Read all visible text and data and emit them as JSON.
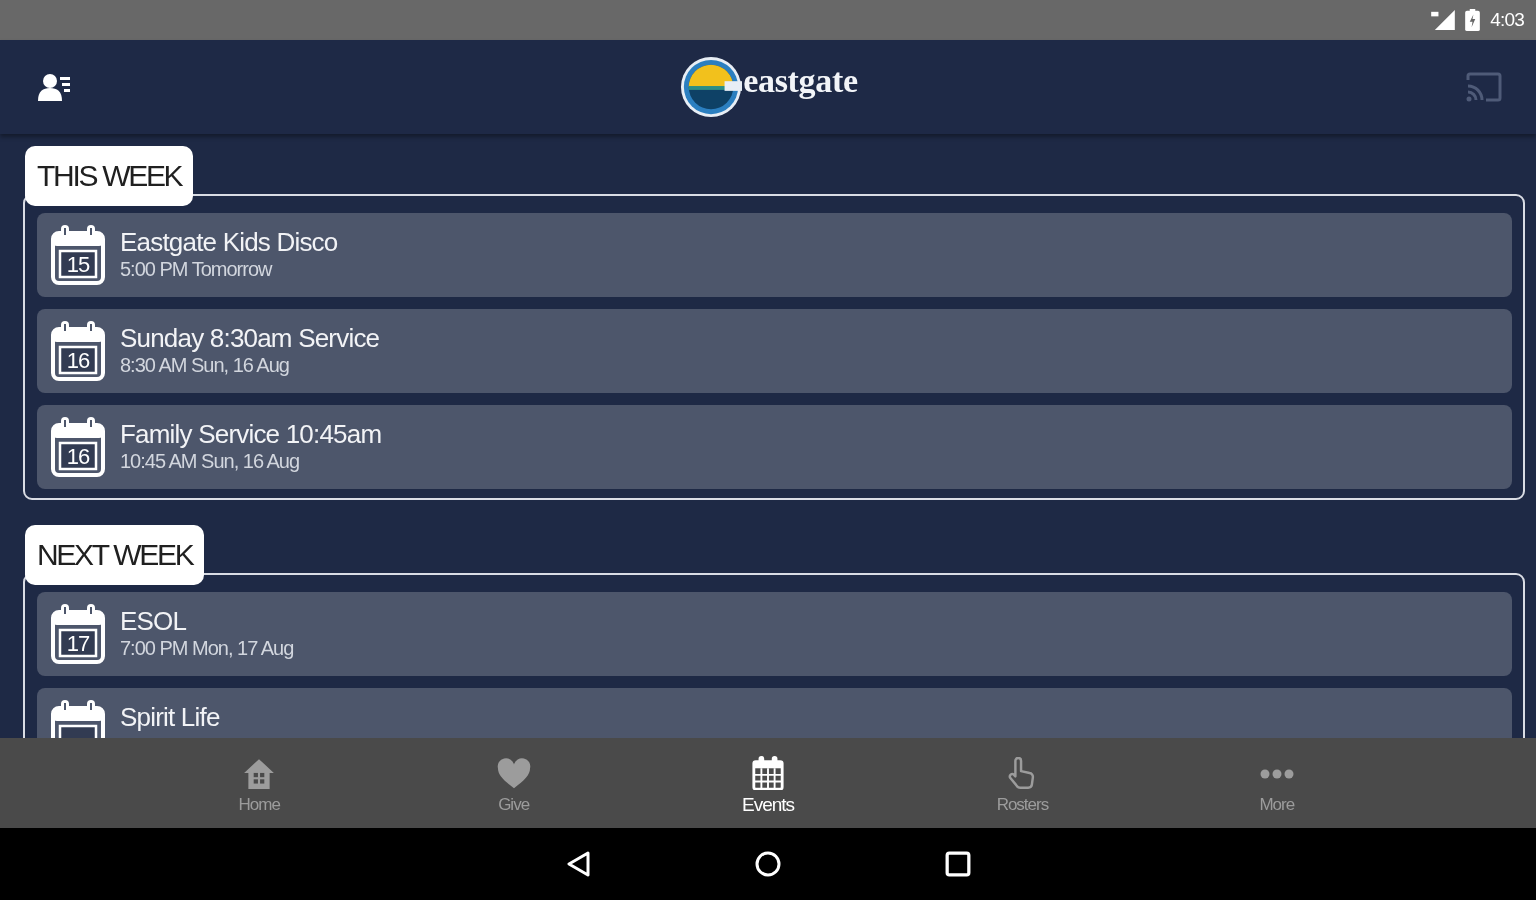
{
  "status_bar": {
    "time": "4:03"
  },
  "app_bar": {
    "logo_text": "eastgate"
  },
  "sections": [
    {
      "title": "THIS WEEK",
      "events": [
        {
          "day": "15",
          "title": "Eastgate Kids Disco",
          "when": "5:00 PM Tomorrow"
        },
        {
          "day": "16",
          "title": "Sunday 8:30am Service",
          "when": "8:30 AM Sun, 16 Aug"
        },
        {
          "day": "16",
          "title": "Family Service 10:45am",
          "when": "10:45 AM Sun, 16 Aug"
        }
      ]
    },
    {
      "title": "NEXT WEEK",
      "events": [
        {
          "day": "17",
          "title": "ESOL",
          "when": "7:00 PM Mon, 17 Aug"
        },
        {
          "title": "Spirit Life"
        }
      ]
    }
  ],
  "bottom_nav": [
    {
      "kind": "house",
      "label": "Home",
      "selected": false
    },
    {
      "kind": "heart",
      "label": "Give",
      "selected": false
    },
    {
      "kind": "calendar",
      "label": "Events",
      "selected": true
    },
    {
      "kind": "hand",
      "label": "Rosters",
      "selected": false
    },
    {
      "kind": "dots",
      "label": "More",
      "selected": false
    }
  ]
}
